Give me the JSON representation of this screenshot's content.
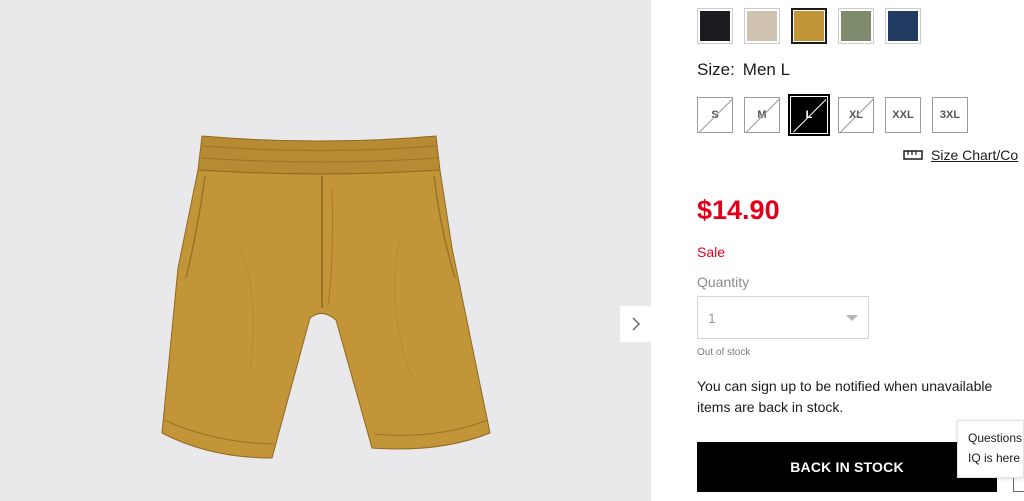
{
  "colors": {
    "accent_red": "#e1001a",
    "swatches": [
      {
        "name": "black",
        "hex": "#1c1c20",
        "selected": false
      },
      {
        "name": "beige",
        "hex": "#cfc3b0",
        "selected": false
      },
      {
        "name": "mustard",
        "hex": "#c39539",
        "selected": true
      },
      {
        "name": "olive",
        "hex": "#7e8c6d",
        "selected": false
      },
      {
        "name": "navy",
        "hex": "#233a63",
        "selected": false
      }
    ]
  },
  "gallery": {
    "next_icon": "chevron-right-icon"
  },
  "size": {
    "label": "Size:",
    "selected_value": "Men L",
    "options": [
      {
        "label": "S",
        "unavailable": true,
        "selected": false
      },
      {
        "label": "M",
        "unavailable": true,
        "selected": false
      },
      {
        "label": "L",
        "unavailable": true,
        "selected": true
      },
      {
        "label": "XL",
        "unavailable": true,
        "selected": false
      },
      {
        "label": "XXL",
        "unavailable": false,
        "selected": false
      },
      {
        "label": "3XL",
        "unavailable": false,
        "selected": false
      }
    ],
    "chart_link": "Size Chart/Co",
    "chart_icon": "ruler-icon"
  },
  "price": {
    "amount": "$14.90",
    "sale_label": "Sale"
  },
  "quantity": {
    "label": "Quantity",
    "value": "1",
    "stock_status": "Out of stock"
  },
  "notify_text": "You can sign up to be notified when unavailable items are back in stock.",
  "back_in_stock_button": "BACK IN STOCK",
  "help_tooltip": {
    "line1": "Questions",
    "line2": "IQ is here"
  }
}
